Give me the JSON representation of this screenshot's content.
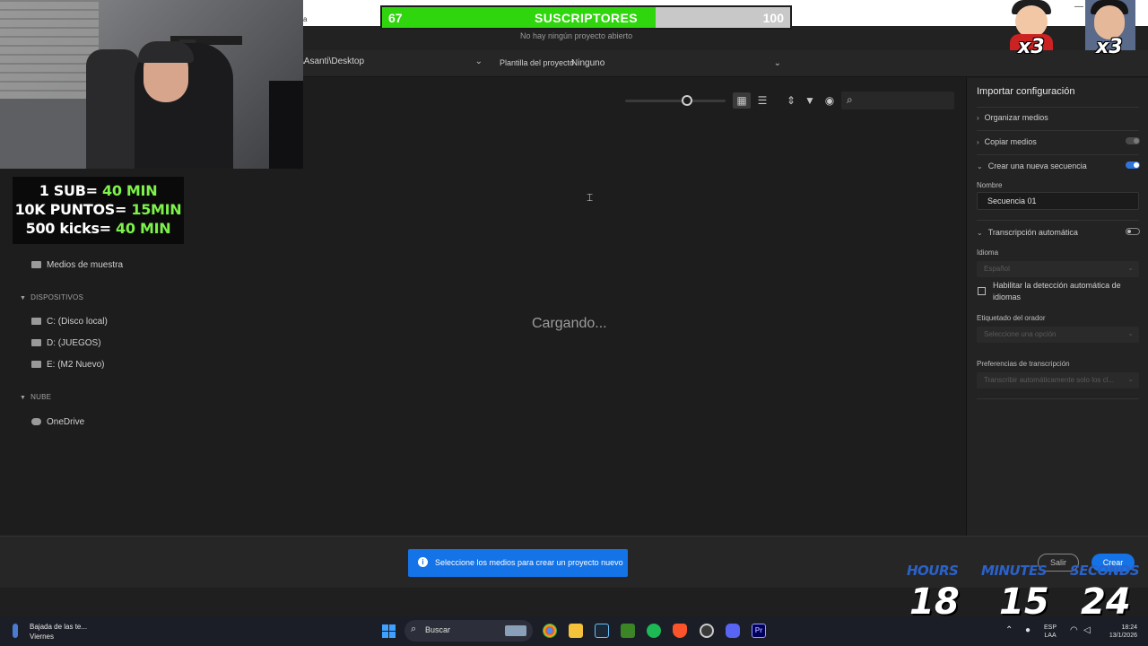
{
  "titlebar": {
    "fragment_left": "a",
    "minimize": "—"
  },
  "header": {
    "no_project": "No hay ningún proyecto abierto"
  },
  "location": {
    "path": "\\Asanti\\Desktop",
    "template_label": "Plantilla del proyecto",
    "template_value": "Ninguno"
  },
  "main": {
    "loading_text": "Cargando..."
  },
  "sidebar": {
    "items_top": [
      {
        "label": "Medios de muestra"
      }
    ],
    "devices_header": "DISPOSITIVOS",
    "devices": [
      {
        "label": "C: (Disco local)"
      },
      {
        "label": "D: (JUEGOS)"
      },
      {
        "label": "E: (M2 Nuevo)"
      }
    ],
    "cloud_header": "NUBE",
    "cloud": [
      {
        "label": "OneDrive"
      }
    ]
  },
  "right_panel": {
    "title": "Importar configuración",
    "organize": "Organizar medios",
    "copy": "Copiar medios",
    "create_seq": "Crear una nueva secuencia",
    "name_label": "Nombre",
    "name_value": "Secuencia 01",
    "auto_transcription": "Transcripción automática",
    "language_label": "Idioma",
    "language_value": "Español",
    "auto_detect": "Habilitar la detección automática de idiomas",
    "speaker_label": "Etiquetado del orador",
    "speaker_value": "Seleccione una opción",
    "prefs_label": "Preferencias de transcripción",
    "prefs_value": "Transcribir automáticamente solo los cl..."
  },
  "bottom": {
    "toast": "Seleccione los medios para crear un proyecto nuevo",
    "exit": "Salir",
    "create": "Crear"
  },
  "taskbar": {
    "weather_line1": "Bajada de las te...",
    "weather_line2": "Viernes",
    "search": "Buscar",
    "lang1": "ESP",
    "lang2": "LAA",
    "time": "18:24",
    "date": "13/1/2026"
  },
  "overlay": {
    "sub_current": "67",
    "sub_label": "SUSCRIPTORES",
    "sub_goal": "100",
    "sub_fraction": 0.67,
    "promo_line1_a": "1 SUB= ",
    "promo_line1_b": "40 MIN",
    "promo_line2_a": "10K PUNTOS= ",
    "promo_line2_b": "15MIN",
    "promo_line3_a": "500 kicks= ",
    "promo_line3_b": "40 MIN",
    "mult1": "x3",
    "mult2": "x3",
    "hours_label": "HOURS",
    "minutes_label": "MINUTES",
    "seconds_label": "SECONDS",
    "hours": "18",
    "minutes": "15",
    "seconds": "24"
  },
  "colors": {
    "accent": "#1473e6",
    "sub_fill": "#2fd60d",
    "promo_green": "#7cf24a",
    "timer_label": "#2b62c9"
  }
}
